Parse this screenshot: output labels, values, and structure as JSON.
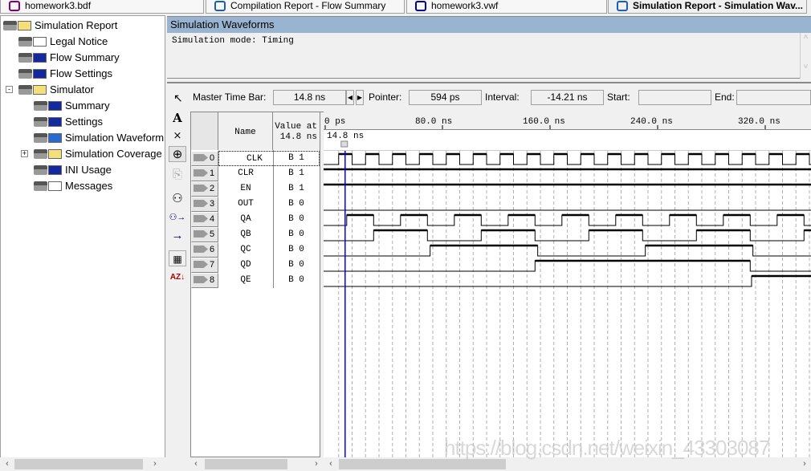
{
  "tabs": [
    {
      "label": "homework3.bdf",
      "icon": "block-diagram-icon",
      "active": false
    },
    {
      "label": "Compilation Report - Flow Summary",
      "icon": "report-icon",
      "active": false
    },
    {
      "label": "homework3.vwf",
      "icon": "waveform-file-icon",
      "active": false
    },
    {
      "label": "Simulation Report - Simulation Wav...",
      "icon": "report-icon",
      "active": true
    }
  ],
  "tree": [
    {
      "label": "Simulation Report",
      "icon": "folder-icon",
      "level": 0
    },
    {
      "label": "Legal Notice",
      "icon": "document-icon",
      "level": 1
    },
    {
      "label": "Flow Summary",
      "icon": "table-icon",
      "level": 1
    },
    {
      "label": "Flow Settings",
      "icon": "table-icon",
      "level": 1
    },
    {
      "label": "Simulator",
      "icon": "folder-icon",
      "level": 1,
      "expander": "-"
    },
    {
      "label": "Summary",
      "icon": "table-icon",
      "level": 2
    },
    {
      "label": "Settings",
      "icon": "table-icon",
      "level": 2
    },
    {
      "label": "Simulation Waveform",
      "icon": "waveform-icon",
      "level": 2
    },
    {
      "label": "Simulation Coverage",
      "icon": "folder-icon",
      "level": 2,
      "expander": "+"
    },
    {
      "label": "INI Usage",
      "icon": "table-icon",
      "level": 2
    },
    {
      "label": "Messages",
      "icon": "info-icon",
      "level": 2
    }
  ],
  "panel": {
    "title": "Simulation Waveforms",
    "mode_text": "Simulation mode: Timing"
  },
  "timebar": {
    "master_label": "Master Time Bar:",
    "master_value": "14.8 ns",
    "pointer_label": "Pointer:",
    "pointer_value": "594 ps",
    "interval_label": "Interval:",
    "interval_value": "-14.21 ns",
    "start_label": "Start:",
    "start_value": "",
    "end_label": "End:",
    "end_value": ""
  },
  "grid": {
    "name_header": "Name",
    "value_header": "Value at",
    "value_header2": "14.8 ns",
    "cursor_label": "14.8 ns",
    "cursor_ns": 14.8,
    "time_ticks": [
      {
        "ns": 0,
        "label": "0 ps"
      },
      {
        "ns": 80,
        "label": "80.0 ns"
      },
      {
        "ns": 160,
        "label": "160.0 ns"
      },
      {
        "ns": 240,
        "label": "240.0 ns"
      },
      {
        "ns": 320,
        "label": "320.0 ns"
      }
    ],
    "gridline_step_ns": 10,
    "colors": {
      "cursor": "#0000ff",
      "wave": "#000000",
      "grid": "#b0b0b0"
    }
  },
  "signals": [
    {
      "index": "0",
      "name": "CLK",
      "value": "B 1",
      "dir": "input",
      "init": 0,
      "toggles": [
        10,
        20,
        30,
        40,
        50,
        60,
        70,
        80,
        90,
        100,
        110,
        120,
        130,
        140,
        150,
        160,
        170,
        180,
        190,
        200,
        210,
        220,
        230,
        240,
        250,
        260,
        270,
        280,
        290,
        300,
        310,
        320,
        330,
        340,
        350,
        360
      ]
    },
    {
      "index": "1",
      "name": "CLR",
      "value": "B 1",
      "dir": "input",
      "init": 1,
      "toggles": []
    },
    {
      "index": "2",
      "name": "EN",
      "value": "B 1",
      "dir": "input",
      "init": 1,
      "toggles": []
    },
    {
      "index": "3",
      "name": "OUT",
      "value": "B 0",
      "dir": "output",
      "init": 0,
      "toggles": []
    },
    {
      "index": "4",
      "name": "QA",
      "value": "B 0",
      "dir": "output",
      "init": 0,
      "toggles": [
        16,
        36,
        56,
        76,
        96,
        116,
        136,
        156,
        176,
        196,
        216,
        236,
        256,
        276,
        296,
        316,
        336,
        356
      ]
    },
    {
      "index": "5",
      "name": "QB",
      "value": "B 0",
      "dir": "output",
      "init": 0,
      "toggles": [
        36,
        76,
        116,
        156,
        196,
        236,
        276,
        316,
        356
      ]
    },
    {
      "index": "6",
      "name": "QC",
      "value": "B 0",
      "dir": "output",
      "init": 0,
      "toggles": [
        78,
        158,
        238,
        318
      ]
    },
    {
      "index": "7",
      "name": "QD",
      "value": "B 0",
      "dir": "output",
      "init": 0,
      "toggles": [
        156,
        316
      ]
    },
    {
      "index": "8",
      "name": "QE",
      "value": "B 0",
      "dir": "output",
      "init": 0,
      "toggles": [
        317
      ]
    }
  ],
  "watermark": "https://blog.csdn.net/weixin_43303087"
}
